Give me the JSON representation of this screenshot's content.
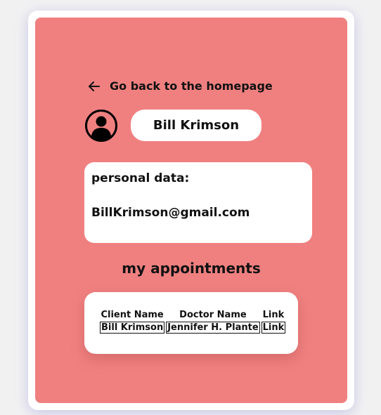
{
  "nav": {
    "back_label": "Go back to the homepage"
  },
  "profile": {
    "name": "Bill Krimson"
  },
  "personal": {
    "heading": "personal data:",
    "email": "BillKrimson@gmail.com"
  },
  "appointments": {
    "title": "my appointments",
    "columns": [
      "Client Name",
      "Doctor Name",
      "Link"
    ],
    "rows": [
      [
        "Bill Krimson",
        "Jennifer H. Plante",
        "Link"
      ]
    ]
  },
  "colors": {
    "panel": "#f08080",
    "card": "#ffffff",
    "text": "#111111"
  },
  "icons": {
    "back": "arrow-left-icon",
    "avatar": "user-circle-icon"
  }
}
